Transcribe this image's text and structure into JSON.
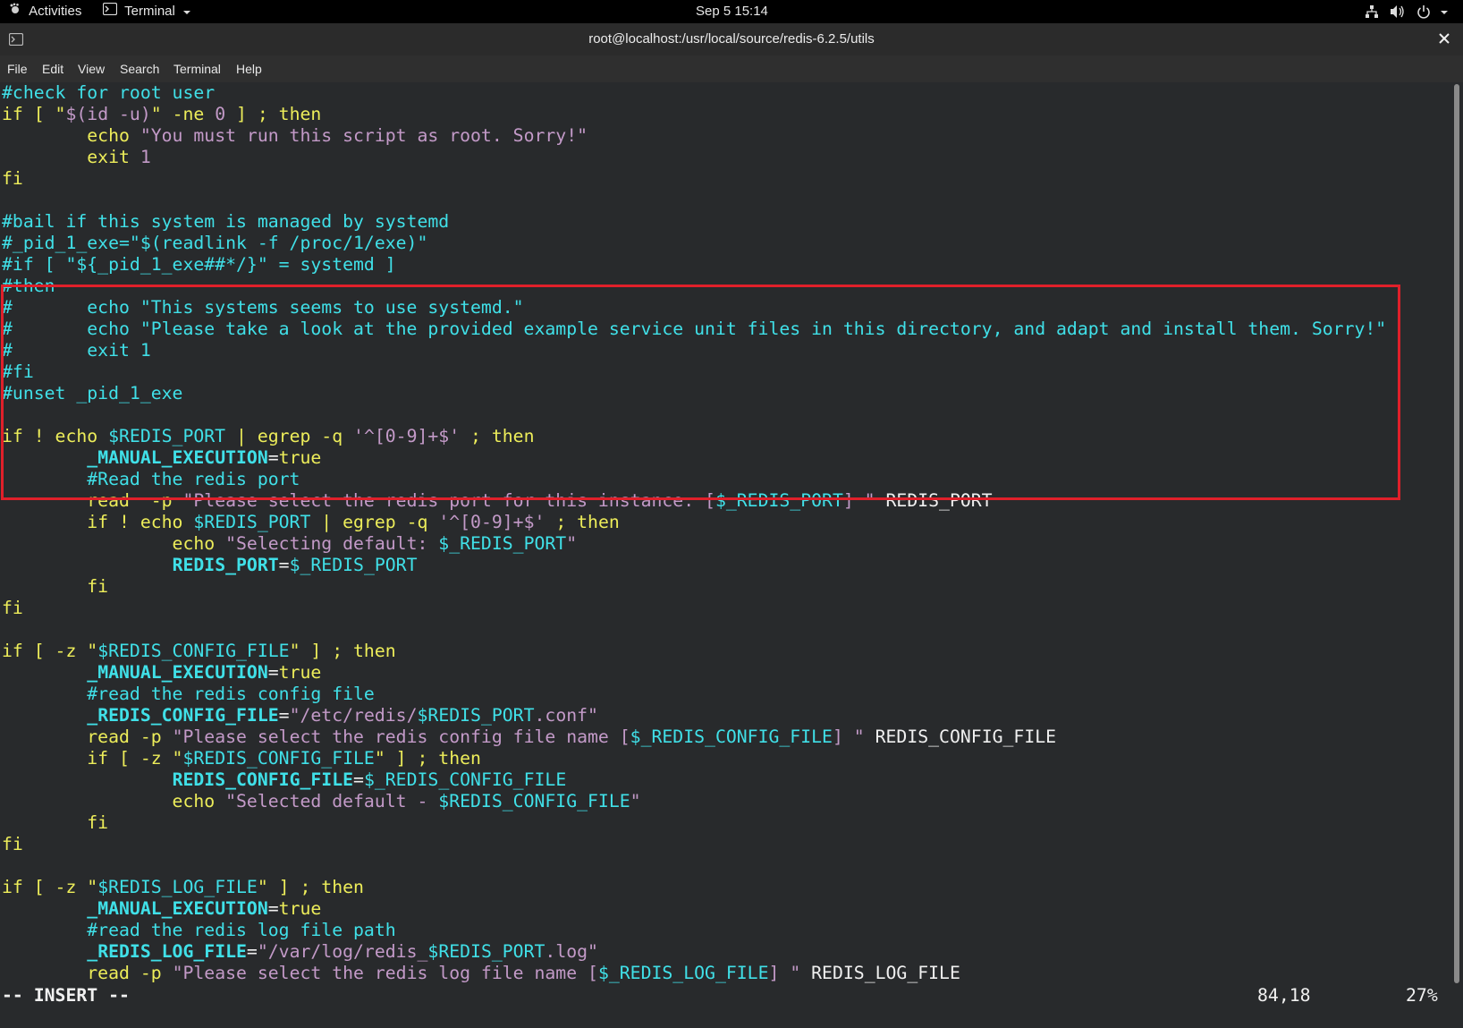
{
  "topbar": {
    "activities": "Activities",
    "app_menu": "Terminal",
    "clock": "Sep 5  15:14"
  },
  "window": {
    "title": "root@localhost:/usr/local/source/redis-6.2.5/utils"
  },
  "menu": {
    "items": [
      "File",
      "Edit",
      "View",
      "Search",
      "Terminal",
      "Help"
    ]
  },
  "editor": {
    "lines": [
      [
        [
          "c",
          "#check for root user"
        ]
      ],
      [
        [
          "y",
          "if [ \""
        ],
        [
          "pk",
          "$(id -u)"
        ],
        [
          "y",
          "\" -ne "
        ],
        [
          "pk",
          "0"
        ],
        [
          "y",
          " ] ; then"
        ]
      ],
      [
        [
          "y",
          "        echo "
        ],
        [
          "pk",
          "\"You must run this script as root. Sorry!\""
        ]
      ],
      [
        [
          "y",
          "        exit "
        ],
        [
          "pk",
          "1"
        ]
      ],
      [
        [
          "y",
          "fi"
        ]
      ],
      [
        [
          "w",
          ""
        ]
      ],
      [
        [
          "c",
          "#bail if this system is managed by systemd"
        ]
      ],
      [
        [
          "c",
          "#_pid_1_exe=\"$(readlink -f /proc/1/exe)\""
        ]
      ],
      [
        [
          "c",
          "#if [ \"${_pid_1_exe##*/}\" = systemd ]"
        ]
      ],
      [
        [
          "c",
          "#then"
        ]
      ],
      [
        [
          "c",
          "#       echo \"This systems seems to use systemd.\""
        ]
      ],
      [
        [
          "c",
          "#       echo \"Please take a look at the provided example service unit files in this directory, and adapt and install them. Sorry!\""
        ]
      ],
      [
        [
          "c",
          "#       exit 1"
        ]
      ],
      [
        [
          "c",
          "#fi"
        ]
      ],
      [
        [
          "c",
          "#unset _pid_1_exe"
        ]
      ],
      [
        [
          "w",
          ""
        ]
      ],
      [
        [
          "y",
          "if ! echo "
        ],
        [
          "c",
          "$REDIS_PORT"
        ],
        [
          "y",
          " | egrep -q "
        ],
        [
          "pk",
          "'^[0-9]+$'"
        ],
        [
          "y",
          " ; then"
        ]
      ],
      [
        [
          "w",
          "        "
        ],
        [
          "cb",
          "_MANUAL_EXECUTION"
        ],
        [
          "w",
          "="
        ],
        [
          "y",
          "true"
        ]
      ],
      [
        [
          "c",
          "        #Read the redis port"
        ]
      ],
      [
        [
          "y",
          "        read  -p "
        ],
        [
          "pk",
          "\"Please select the redis port for this instance: ["
        ],
        [
          "c",
          "$_REDIS_PORT"
        ],
        [
          "pk",
          "] \""
        ],
        [
          "w",
          " REDIS_PORT"
        ]
      ],
      [
        [
          "y",
          "        if ! echo "
        ],
        [
          "c",
          "$REDIS_PORT"
        ],
        [
          "y",
          " | egrep -q "
        ],
        [
          "pk",
          "'^[0-9]+$'"
        ],
        [
          "y",
          " ; then"
        ]
      ],
      [
        [
          "y",
          "                echo "
        ],
        [
          "pk",
          "\"Selecting default: "
        ],
        [
          "c",
          "$_REDIS_PORT"
        ],
        [
          "pk",
          "\""
        ]
      ],
      [
        [
          "w",
          "                "
        ],
        [
          "cb",
          "REDIS_PORT"
        ],
        [
          "w",
          "="
        ],
        [
          "c",
          "$_REDIS_PORT"
        ]
      ],
      [
        [
          "y",
          "        fi"
        ]
      ],
      [
        [
          "y",
          "fi"
        ]
      ],
      [
        [
          "w",
          ""
        ]
      ],
      [
        [
          "y",
          "if [ -z \""
        ],
        [
          "c",
          "$REDIS_CONFIG_FILE"
        ],
        [
          "y",
          "\" ] ; then"
        ]
      ],
      [
        [
          "w",
          "        "
        ],
        [
          "cb",
          "_MANUAL_EXECUTION"
        ],
        [
          "w",
          "="
        ],
        [
          "y",
          "true"
        ]
      ],
      [
        [
          "c",
          "        #read the redis config file"
        ]
      ],
      [
        [
          "w",
          "        "
        ],
        [
          "cb",
          "_REDIS_CONFIG_FILE"
        ],
        [
          "w",
          "="
        ],
        [
          "pk",
          "\"/etc/redis/"
        ],
        [
          "c",
          "$REDIS_PORT"
        ],
        [
          "pk",
          ".conf\""
        ]
      ],
      [
        [
          "y",
          "        read -p "
        ],
        [
          "pk",
          "\"Please select the redis config file name ["
        ],
        [
          "c",
          "$_REDIS_CONFIG_FILE"
        ],
        [
          "pk",
          "] \""
        ],
        [
          "w",
          " REDIS_CONFIG_FILE"
        ]
      ],
      [
        [
          "y",
          "        if [ -z \""
        ],
        [
          "c",
          "$REDIS_CONFIG_FILE"
        ],
        [
          "y",
          "\" ] ; then"
        ]
      ],
      [
        [
          "w",
          "                "
        ],
        [
          "cb",
          "REDIS_CONFIG_FILE"
        ],
        [
          "w",
          "="
        ],
        [
          "c",
          "$_REDIS_CONFIG_FILE"
        ]
      ],
      [
        [
          "y",
          "                echo "
        ],
        [
          "pk",
          "\"Selected default - "
        ],
        [
          "c",
          "$REDIS_CONFIG_FILE"
        ],
        [
          "pk",
          "\""
        ]
      ],
      [
        [
          "y",
          "        fi"
        ]
      ],
      [
        [
          "y",
          "fi"
        ]
      ],
      [
        [
          "w",
          ""
        ]
      ],
      [
        [
          "y",
          "if [ -z \""
        ],
        [
          "c",
          "$REDIS_LOG_FILE"
        ],
        [
          "y",
          "\" ] ; then"
        ]
      ],
      [
        [
          "w",
          "        "
        ],
        [
          "cb",
          "_MANUAL_EXECUTION"
        ],
        [
          "w",
          "="
        ],
        [
          "y",
          "true"
        ]
      ],
      [
        [
          "c",
          "        #read the redis log file path"
        ]
      ],
      [
        [
          "w",
          "        "
        ],
        [
          "cb",
          "_REDIS_LOG_FILE"
        ],
        [
          "w",
          "="
        ],
        [
          "pk",
          "\"/var/log/redis_"
        ],
        [
          "c",
          "$REDIS_PORT"
        ],
        [
          "pk",
          ".log\""
        ]
      ],
      [
        [
          "y",
          "        read -p "
        ],
        [
          "pk",
          "\"Please select the redis log file name ["
        ],
        [
          "c",
          "$_REDIS_LOG_FILE"
        ],
        [
          "pk",
          "] \""
        ],
        [
          "w",
          " REDIS_LOG_FILE"
        ]
      ]
    ],
    "mode": "-- INSERT --",
    "cursor_position": "84,18",
    "scroll_percent": "27%"
  },
  "colors": {
    "highlight_box": "#e0202a",
    "yellow": "#eded5a",
    "cyan": "#40e0e8",
    "pink": "#c39ac8"
  }
}
